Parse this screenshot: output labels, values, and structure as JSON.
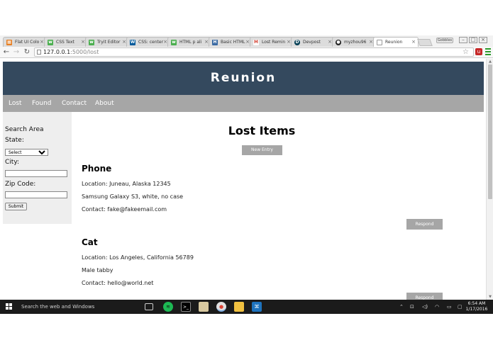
{
  "browser": {
    "tabs": [
      {
        "label": "Flat UI Colo",
        "icon": "flat-ui-favicon",
        "color": "#e67e22"
      },
      {
        "label": "CSS Text",
        "icon": "w3-favicon",
        "color": "#4caf50"
      },
      {
        "label": "Tryit Editor",
        "icon": "w3-favicon",
        "color": "#4caf50"
      },
      {
        "label": "CSS: center",
        "icon": "w3c-favicon",
        "color": "#005a9c"
      },
      {
        "label": "HTML p ali",
        "icon": "w3-favicon",
        "color": "#4caf50"
      },
      {
        "label": "Basic HTML",
        "icon": "hg-favicon",
        "color": "#3a6aa3"
      },
      {
        "label": "Lost Remin",
        "icon": "gmail-favicon",
        "color": "#d44638"
      },
      {
        "label": "Devpost",
        "icon": "devpost-favicon",
        "color": "#003e54"
      },
      {
        "label": "myzhou96",
        "icon": "github-favicon",
        "color": "#222222"
      },
      {
        "label": "Reunion",
        "icon": "page-favicon",
        "color": "#9e9e9e",
        "active": true
      }
    ],
    "profile_label": "Gobbles",
    "url_host": "127.0.0.1",
    "url_path": ":5000/lost"
  },
  "site": {
    "title": "Reunion",
    "header_color": "#34495e",
    "nav": [
      {
        "label": "Lost"
      },
      {
        "label": "Found"
      },
      {
        "label": "Contact"
      },
      {
        "label": "About"
      }
    ]
  },
  "sidebar": {
    "heading": "Search Area",
    "state_label": "State:",
    "state_selected": "Select",
    "city_label": "City:",
    "city_value": "",
    "zip_label": "Zip Code:",
    "zip_value": "",
    "submit_label": "Submit"
  },
  "main": {
    "title": "Lost Items",
    "new_entry_label": "New Entry",
    "items": [
      {
        "name": "Phone",
        "location": "Location: Juneau, Alaska 12345",
        "description": "Samsung Galaxy S3, white, no case",
        "contact": "Contact: fake@fakeemail.com",
        "respond_label": "Respond"
      },
      {
        "name": "Cat",
        "location": "Location: Los Angeles, California 56789",
        "description": "Male tabby",
        "contact": "Contact: hello@world.net",
        "respond_label": "Respond"
      }
    ]
  },
  "taskbar": {
    "search_placeholder": "Search the web and Windows",
    "time": "6:54 AM",
    "date": "1/17/2016"
  }
}
